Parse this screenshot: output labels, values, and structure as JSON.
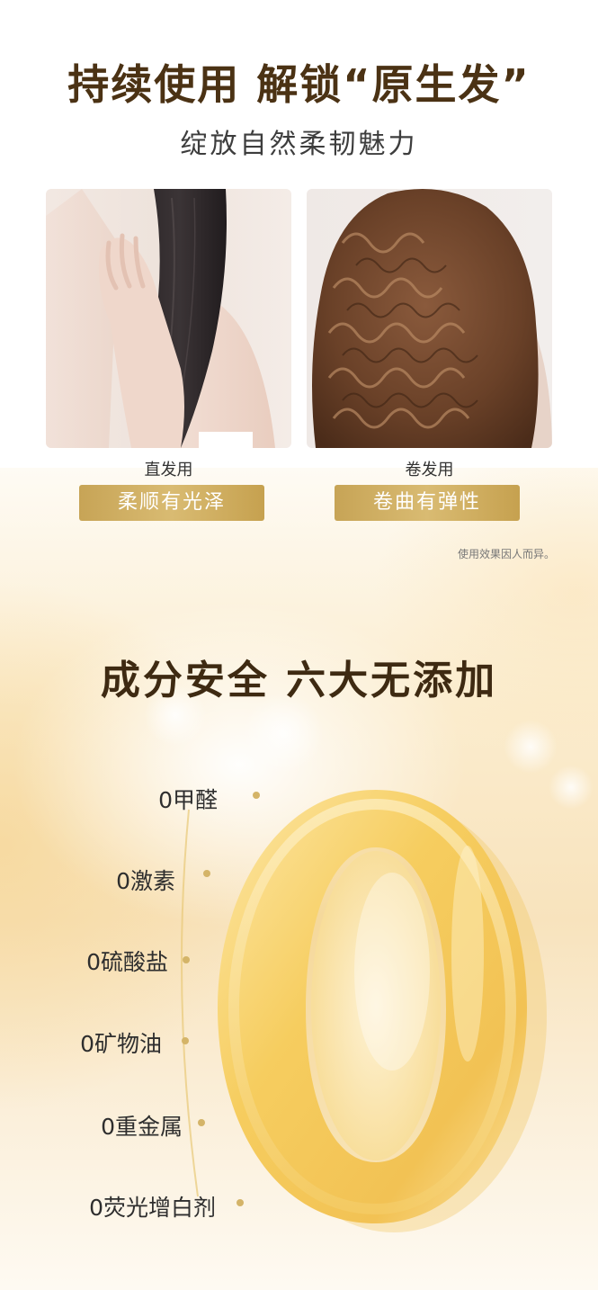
{
  "header": {
    "title": "持续使用 解锁“原生发”",
    "subtitle": "绽放自然柔韧魅力"
  },
  "hair_types": [
    {
      "caption": "直发用",
      "badge": "柔顺有光泽"
    },
    {
      "caption": "卷发用",
      "badge": "卷曲有弹性"
    }
  ],
  "disclaimer": "使用效果因人而异。",
  "ingredients_section": {
    "title": "成分安全 六大无添加",
    "big_numeral": "0",
    "items": [
      "0甲醛",
      "0激素",
      "0硫酸盐",
      "0矿物油",
      "0重金属",
      "0荧光增白剂"
    ]
  },
  "colors": {
    "title_brown": "#4b3214",
    "badge_gold": "#c9a85a",
    "numeral_gold": "#f2c85a"
  }
}
